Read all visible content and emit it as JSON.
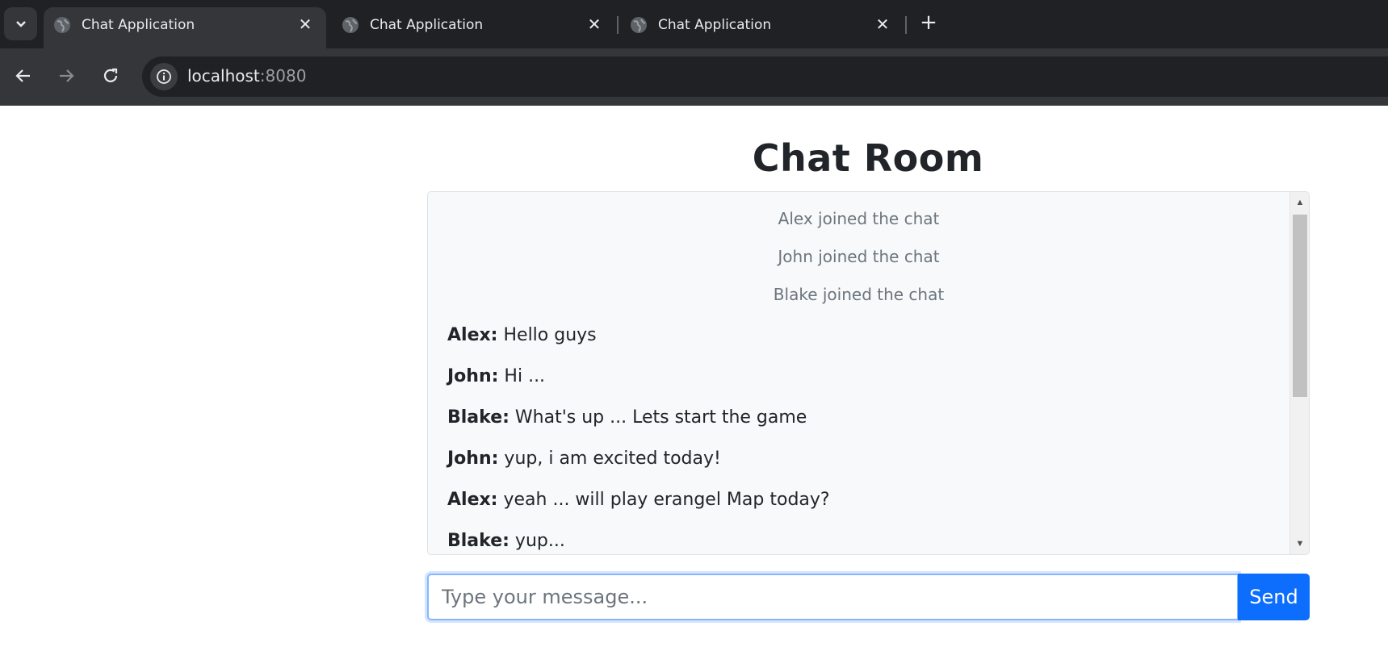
{
  "browser": {
    "tabs": [
      {
        "title": "Chat Application",
        "active": true
      },
      {
        "title": "Chat Application",
        "active": false
      },
      {
        "title": "Chat Application",
        "active": false
      }
    ],
    "url_host": "localhost",
    "url_port": ":8080",
    "icons": {
      "tab_menu": "chevron-down-icon",
      "tab_favicon": "globe-icon",
      "tab_close": "close-icon",
      "new_tab": "plus-icon",
      "back": "arrow-left-icon",
      "forward": "arrow-right-icon",
      "reload": "reload-icon",
      "site_info": "info-icon"
    }
  },
  "chat": {
    "heading": "Chat Room",
    "system_messages": [
      "Alex joined the chat",
      "John joined the chat",
      "Blake joined the chat"
    ],
    "messages": [
      {
        "sender": "Alex:",
        "text": "Hello guys"
      },
      {
        "sender": "John:",
        "text": "Hi ..."
      },
      {
        "sender": "Blake:",
        "text": "What's up ... Lets start the game"
      },
      {
        "sender": "John:",
        "text": "yup, i am excited today!"
      },
      {
        "sender": "Alex:",
        "text": "yeah ... will play erangel Map today?"
      },
      {
        "sender": "Blake:",
        "text": "yup..."
      }
    ],
    "input_placeholder": "Type your message...",
    "input_value": "",
    "send_label": "Send"
  },
  "colors": {
    "accent": "#0d6efd",
    "muted_text": "#6c757d",
    "chrome_dark": "#202124",
    "chrome_mid": "#35363a"
  }
}
